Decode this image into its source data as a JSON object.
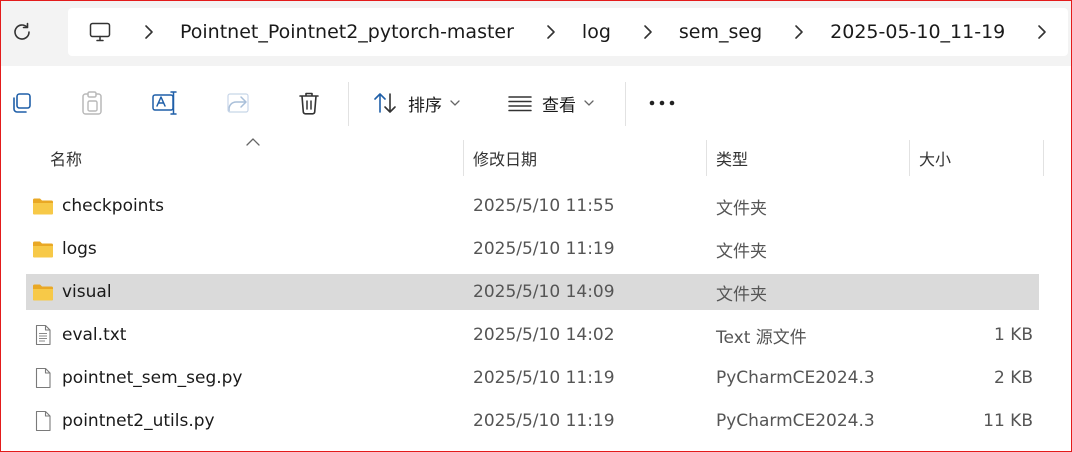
{
  "address_bar": {
    "breadcrumbs": [
      "Pointnet_Pointnet2_pytorch-master",
      "log",
      "sem_seg",
      "2025-05-10_11-19"
    ]
  },
  "toolbar": {
    "sort_label": "排序",
    "view_label": "查看",
    "more_label": "..."
  },
  "columns": {
    "name": "名称",
    "modified": "修改日期",
    "type": "类型",
    "size": "大小"
  },
  "files": [
    {
      "name": "checkpoints",
      "modified": "2025/5/10 11:55",
      "type": "文件夹",
      "size": "",
      "icon": "folder-icon"
    },
    {
      "name": "logs",
      "modified": "2025/5/10 11:19",
      "type": "文件夹",
      "size": "",
      "icon": "folder-icon"
    },
    {
      "name": "visual",
      "modified": "2025/5/10 14:09",
      "type": "文件夹",
      "size": "",
      "icon": "folder-icon",
      "selected": true
    },
    {
      "name": "eval.txt",
      "modified": "2025/5/10 14:02",
      "type": "Text 源文件",
      "size": "1 KB",
      "icon": "text-file-icon"
    },
    {
      "name": "pointnet_sem_seg.py",
      "modified": "2025/5/10 11:19",
      "type": "PyCharmCE2024.3",
      "size": "2 KB",
      "icon": "file-icon"
    },
    {
      "name": "pointnet2_utils.py",
      "modified": "2025/5/10 11:19",
      "type": "PyCharmCE2024.3",
      "size": "11 KB",
      "icon": "file-icon"
    }
  ],
  "colors": {
    "selection": "#dadada",
    "folder": "#f7c948",
    "frame": "#e31b1b"
  }
}
